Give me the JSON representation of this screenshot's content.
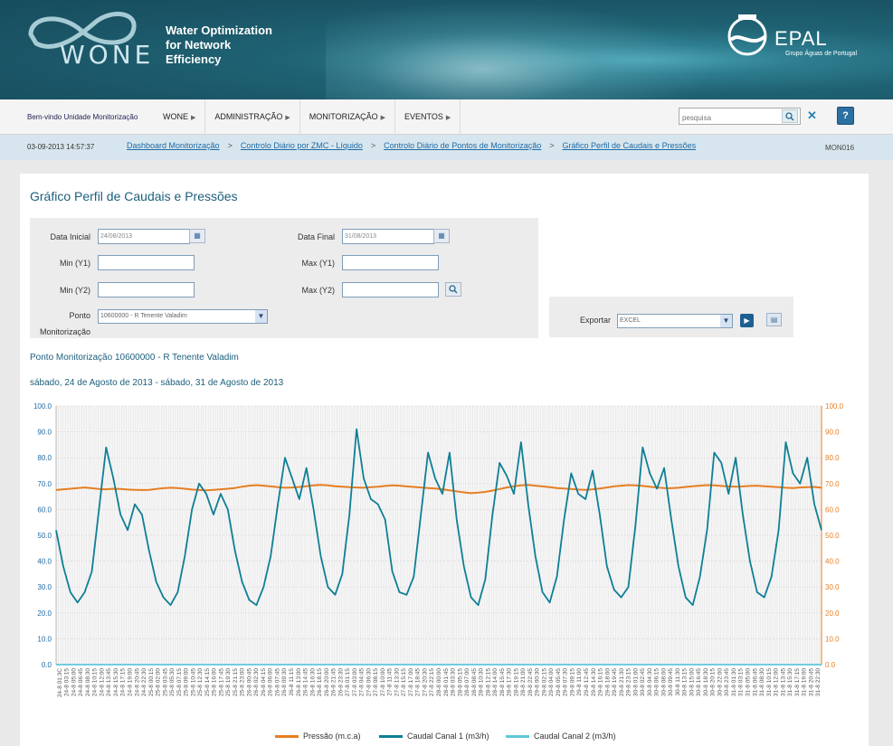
{
  "header": {
    "logo_text": "WONE",
    "tagline_lines": [
      "Water Optimization",
      "for Network",
      "Efficiency"
    ],
    "brand": "EPAL",
    "brand_sub": "Grupo Águas de Portugal"
  },
  "nav": {
    "welcome": "Bem-vindo Unidade Monitorização",
    "menu": [
      "WONE",
      "ADMINISTRAÇÃO",
      "MONITORIZAÇÃO",
      "EVENTOS"
    ],
    "search_placeholder": "pesquisa",
    "help_label": "?"
  },
  "breadcrumb": {
    "datetime": "03-09-2013 14:57:37",
    "items": [
      "Dashboard Monitorização",
      "Controlo Diário por ZMC - Líquido",
      "Controlo Diário de Pontos de Monitorização",
      "Gráfico Perfil de Caudais e Pressões"
    ],
    "separator": ">",
    "code": "MON016"
  },
  "page": {
    "title": "Gráfico Perfil de Caudais e Pressões",
    "filters": {
      "data_inicial_label": "Data Inicial",
      "data_inicial_value": "24/08/2013",
      "data_final_label": "Data Final",
      "data_final_value": "31/08/2013",
      "min_y1_label": "Min (Y1)",
      "max_y1_label": "Max (Y1)",
      "min_y2_label": "Min (Y2)",
      "max_y2_label": "Max (Y2)",
      "ponto_label_1": "Ponto",
      "ponto_label_2": "Monitorização",
      "ponto_value": "10600000 - R Tenente Valadim"
    },
    "export": {
      "label": "Exportar",
      "value": "EXCEL"
    },
    "info_ponto": "Ponto Monitorização 10600000 - R Tenente Valadim",
    "info_periodo": "sábado, 24 de Agosto de 2013 - sábado, 31 de Agosto de 2013"
  },
  "chart_data": {
    "type": "line",
    "y_left": {
      "min": 0,
      "max": 100,
      "ticks": [
        "0.0",
        "10.0",
        "20.0",
        "30.0",
        "40.0",
        "50.0",
        "60.0",
        "70.0",
        "80.0",
        "90.0",
        "100.0"
      ]
    },
    "y_right": {
      "min": 0,
      "max": 100,
      "ticks": [
        "0.0",
        "10.0",
        "20.0",
        "30.0",
        "40.0",
        "50.0",
        "60.0",
        "70.0",
        "80.0",
        "90.0",
        "100.0"
      ]
    },
    "x_range": [
      "24-8 01:00",
      "31-8 23:00"
    ],
    "x_tick_labels": [
      "24-8 01:3C",
      "24-8 03:15",
      "24-8 05:00",
      "24-8 06:45",
      "24-8 08:30",
      "24-8 10:15",
      "24-8 12:00",
      "24-8 13:45",
      "24-8 15:30",
      "24-8 17:15",
      "24-8 19:00",
      "24-8 20:45",
      "24-8 22:30",
      "25-8 00:15",
      "25-8 02:00",
      "25-8 03:45",
      "25-8 05:30",
      "25-8 07:15",
      "25-8 09:00",
      "25-8 10:45",
      "25-8 12:30",
      "25-8 14:15",
      "25-8 16:00",
      "25-8 17:45",
      "25-8 19:30",
      "25-8 21:15",
      "25-8 23:00",
      "26-8 00:45",
      "26-8 02:30",
      "26-8 04:15",
      "26-8 06:00",
      "26-8 07:45",
      "26-8 09:30",
      "26-8 11:15",
      "26-8 13:00",
      "26-8 14:45",
      "26-8 16:30",
      "26-8 18:15",
      "26-8 20:00",
      "26-8 21:45",
      "26-8 23:30",
      "27-8 01:15",
      "27-8 03:00",
      "27-8 04:45",
      "27-8 06:30",
      "27-8 08:15",
      "27-8 10:00",
      "27-8 11:45",
      "27-8 13:30",
      "27-8 15:15",
      "27-8 17:00",
      "27-8 18:45",
      "27-8 20:30",
      "27-8 22:15",
      "28-8 00:00",
      "28-8 01:45",
      "28-8 03:30",
      "28-8 05:15",
      "28-8 07:00",
      "28-8 08:45",
      "28-8 10:30",
      "28-8 12:15",
      "28-8 14:00",
      "28-8 15:45",
      "28-8 17:30",
      "28-8 19:15",
      "28-8 21:00",
      "28-8 22:45",
      "29-8 00:30",
      "29-8 02:15",
      "29-8 04:00",
      "29-8 05:45",
      "29-8 07:30",
      "29-8 09:15",
      "29-8 11:00",
      "29-8 12:45",
      "29-8 14:30",
      "29-8 16:15",
      "29-8 18:00",
      "29-8 19:45",
      "29-8 21:30",
      "29-8 23:15",
      "30-8 01:00",
      "30-8 02:45",
      "30-8 04:30",
      "30-8 06:15",
      "30-8 08:00",
      "30-8 09:45",
      "30-8 11:30",
      "30-8 13:15",
      "30-8 15:00",
      "30-8 16:45",
      "30-8 18:30",
      "30-8 20:15",
      "30-8 22:00",
      "30-8 23:45",
      "31-8 01:30",
      "31-8 03:15",
      "31-8 05:00",
      "31-8 06:45",
      "31-8 08:30",
      "31-8 10:15",
      "31-8 12:00",
      "31-8 13:45",
      "31-8 15:30",
      "31-8 17:15",
      "31-8 19:00",
      "31-8 20:45",
      "31-8 22:30"
    ],
    "series": [
      {
        "name": "Pressão (m.c.a)",
        "color": "#e67e22",
        "axis": "right",
        "values": [
          67.5,
          67.8,
          68.0,
          68.3,
          68.5,
          68.2,
          67.9,
          67.8,
          68.0,
          67.9,
          67.7,
          67.6,
          67.5,
          67.6,
          67.9,
          68.2,
          68.4,
          68.3,
          68.0,
          67.7,
          67.5,
          67.4,
          67.6,
          67.8,
          68.0,
          68.3,
          68.8,
          69.2,
          69.4,
          69.2,
          68.9,
          68.6,
          68.4,
          68.5,
          68.7,
          69.0,
          69.3,
          69.5,
          69.3,
          69.0,
          68.8,
          68.6,
          68.5,
          68.4,
          68.6,
          68.8,
          69.1,
          69.3,
          69.2,
          68.9,
          68.7,
          68.5,
          68.3,
          68.1,
          67.8,
          67.4,
          67.0,
          66.6,
          66.3,
          66.5,
          66.8,
          67.3,
          67.9,
          68.5,
          69.0,
          69.3,
          69.5,
          69.2,
          68.9,
          68.6,
          68.3,
          68.1,
          67.9,
          67.7,
          67.6,
          67.8,
          68.1,
          68.5,
          68.9,
          69.2,
          69.4,
          69.3,
          69.1,
          68.8,
          68.5,
          68.3,
          68.2,
          68.4,
          68.7,
          69.0,
          69.2,
          69.4,
          69.3,
          69.1,
          68.9,
          68.8,
          68.9,
          69.1,
          69.2,
          69.0,
          68.8,
          68.6,
          68.4,
          68.3,
          68.5,
          68.6,
          68.7,
          68.4
        ]
      },
      {
        "name": "Caudal Canal 1 (m3/h)",
        "color": "#0e7f96",
        "axis": "left",
        "values": [
          52,
          38,
          28,
          24,
          28,
          36,
          60,
          84,
          72,
          58,
          52,
          62,
          58,
          44,
          32,
          26,
          23,
          28,
          42,
          60,
          70,
          66,
          58,
          66,
          60,
          44,
          32,
          25,
          23,
          30,
          42,
          62,
          80,
          72,
          64,
          76,
          60,
          42,
          30,
          27,
          35,
          58,
          91,
          72,
          64,
          62,
          56,
          36,
          28,
          27,
          34,
          58,
          82,
          72,
          66,
          82,
          56,
          38,
          26,
          23,
          33,
          58,
          78,
          73,
          66,
          86,
          62,
          42,
          28,
          24,
          34,
          56,
          74,
          66,
          64,
          75,
          58,
          38,
          29,
          26,
          30,
          54,
          84,
          74,
          68,
          76,
          56,
          38,
          26,
          23,
          34,
          52,
          82,
          78,
          66,
          80,
          58,
          40,
          28,
          26,
          34,
          52,
          86,
          74,
          70,
          80,
          62,
          52
        ]
      },
      {
        "name": "Caudal Canal 2 (m3/h)",
        "color": "#5ec8d8",
        "axis": "left",
        "values": [
          0,
          0,
          0,
          0,
          0,
          0,
          0,
          0,
          0,
          0,
          0,
          0,
          0,
          0,
          0,
          0,
          0,
          0,
          0,
          0,
          0,
          0,
          0,
          0,
          0,
          0,
          0,
          0,
          0,
          0,
          0,
          0,
          0,
          0,
          0,
          0,
          0,
          0,
          0,
          0,
          0,
          0,
          0,
          0,
          0,
          0,
          0,
          0,
          0,
          0,
          0,
          0,
          0,
          0,
          0,
          0,
          0,
          0,
          0,
          0,
          0,
          0,
          0,
          0,
          0,
          0,
          0,
          0,
          0,
          0,
          0,
          0,
          0,
          0,
          0,
          0,
          0,
          0,
          0,
          0,
          0,
          0,
          0,
          0,
          0,
          0,
          0,
          0,
          0,
          0,
          0,
          0,
          0,
          0,
          0,
          0,
          0,
          0,
          0,
          0,
          0,
          0,
          0,
          0,
          0,
          0,
          0,
          0
        ]
      }
    ],
    "grid": true,
    "legend_position": "bottom"
  }
}
